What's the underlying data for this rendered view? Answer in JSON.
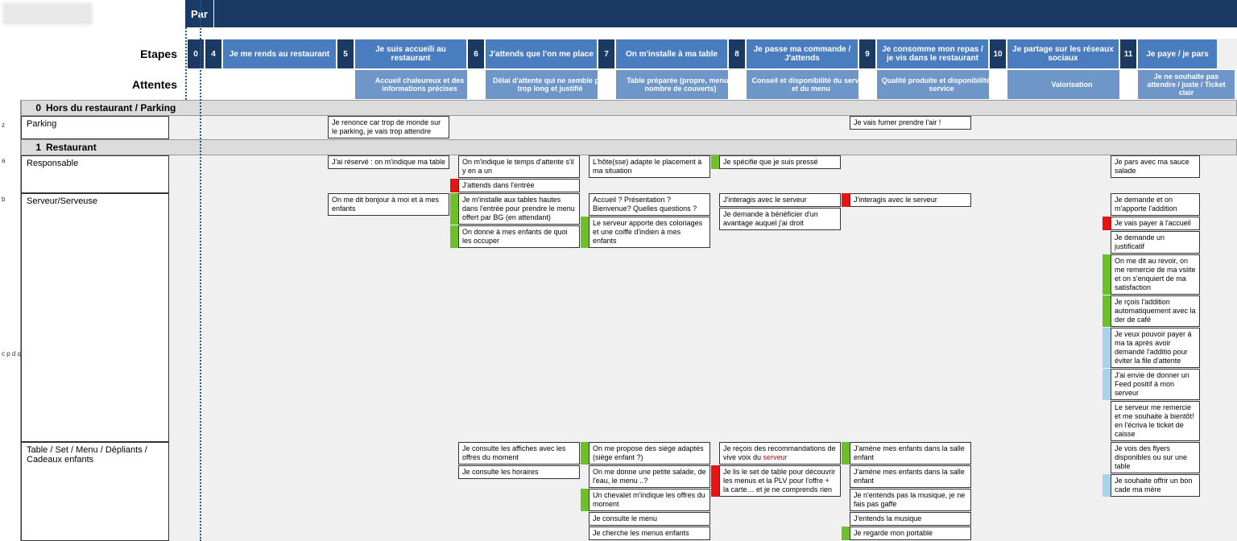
{
  "topbar": {
    "par_label": "Par"
  },
  "labels": {
    "etapes": "Etapes",
    "attentes": "Attentes"
  },
  "stages": [
    {
      "n": "0",
      "title": "",
      "attente": ""
    },
    {
      "n": "4",
      "title": "Je me rends au restaurant",
      "attente": ""
    },
    {
      "n": "5",
      "title": "Je suis accueili au restaurant",
      "attente": "Accueil chaleureux et des informations précises"
    },
    {
      "n": "6",
      "title": "J'attends que l'on me place",
      "attente": "Délai d'attente qui ne semble pas trop long et justifié"
    },
    {
      "n": "7",
      "title": "On m'installe à ma table",
      "attente": "Table préparée (propre, menus, nombre de couverts)"
    },
    {
      "n": "8",
      "title": "Je passe ma commande / J'attends",
      "attente": "Conseil et disponibilité du serveur et du menu"
    },
    {
      "n": "9",
      "title": "Je consomme mon repas / je vis dans le restaurant",
      "attente": "Qualité produite et disponibilité du service"
    },
    {
      "n": "10",
      "title": "Je partage sur les réseaux sociaux",
      "attente": "Valorisation"
    },
    {
      "n": "11",
      "title": "Je paye / je pars",
      "attente": "Je ne souhaite pas attendre / juste / Ticket clair"
    }
  ],
  "sections": [
    {
      "num": "0",
      "title": "Hors du restaurant / Parking"
    },
    {
      "num": "1",
      "title": "Restaurant"
    }
  ],
  "rows": {
    "parking": {
      "id": "z",
      "label": "Parking",
      "cols": {
        "c5": [
          {
            "tag": "none",
            "text": "Je renonce car trop de monde sur le parking, je vais trop attendre"
          }
        ],
        "c9": [
          {
            "tag": "none",
            "text": "Je vais fumer prendre l'air !"
          }
        ]
      }
    },
    "responsable": {
      "id": "a",
      "label": "Responsable",
      "cols": {
        "c5": [
          {
            "tag": "none",
            "text": "J'ai réservé : on m'indique ma table"
          }
        ],
        "c6": [
          {
            "tag": "none",
            "text": "On m'indique le temps d'attente s'il y en a un"
          },
          {
            "tag": "red",
            "text": "J'attends dans l'entrée"
          }
        ],
        "c7": [
          {
            "tag": "none",
            "text": "L'hôte(sse) adapte le placement à ma situation"
          }
        ],
        "c8": [
          {
            "tag": "green",
            "text": "Je spécifie que je suis pressé"
          }
        ],
        "c11": [
          {
            "tag": "none",
            "text": "Je pars avec ma sauce salade"
          }
        ]
      }
    },
    "serveur": {
      "id": "b",
      "label": "Serveur/Serveuse",
      "cols": {
        "c5": [
          {
            "tag": "none",
            "text": "On me dit bonjour à moi et à mes enfants"
          }
        ],
        "c6": [
          {
            "tag": "green",
            "text": "Je m'installe aux tables hautes dans l'entrée pour prendre le menu offert par BG (en attendant)"
          },
          {
            "tag": "green",
            "text": "On donne à mes enfants de quoi les occuper"
          }
        ],
        "c7": [
          {
            "tag": "none",
            "text": "Accueil ? Présentation ? Bienvenue? Quelles questions ?"
          },
          {
            "tag": "green",
            "text": "Le serveur apporte des coloriages et une coiffe d'indien à mes enfants"
          }
        ],
        "c8": [
          {
            "tag": "none",
            "text": "J'interagis avec le serveur"
          },
          {
            "tag": "none",
            "text": "Je demande à bénéficier d'un avantage auquel j'ai droit"
          }
        ],
        "c9": [
          {
            "tag": "red",
            "text": "J'interagis avec le serveur"
          }
        ],
        "c11": [
          {
            "tag": "none",
            "text": "Je demande et on m'apporte l'addition"
          },
          {
            "tag": "red",
            "text": "Je vais payer à l'accueil"
          },
          {
            "tag": "none",
            "text": "Je demande un justificatif"
          },
          {
            "tag": "green",
            "text": "On me dit au revoir, on me remercie de ma vsiite et on s'enquiert de ma satisfaction"
          },
          {
            "tag": "green",
            "text": "Je rçois l'addition automatiquement avec la der de café"
          },
          {
            "tag": "blue",
            "text": "Je veux pouvoir payer à ma ta après avoir demandé l'additio pour éviter la file d'attente"
          },
          {
            "tag": "blue",
            "text": "J'ai envie de donner un Feed positif à mon serveur"
          },
          {
            "tag": "none",
            "text": "Le serveur me remercie et me souhaite à bientôt! en l'écriva le ticket de caisse"
          }
        ]
      }
    },
    "table": {
      "id": "c p d q r",
      "label": "Table / Set / Menu / Dépliants / Cadeaux enfants",
      "cols": {
        "c6": [
          {
            "tag": "none",
            "text": "Je consulte les affiches avec les offres du moment"
          },
          {
            "tag": "none",
            "text": "Je consulte les horaires"
          }
        ],
        "c7": [
          {
            "tag": "green",
            "text": "On me propose des siège adaptés (siège enfant ?)"
          },
          {
            "tag": "none",
            "text": "On me donne une petite salade, de l'eau, le menu ..?"
          },
          {
            "tag": "green",
            "text": "Un chevalet m'indique les offres du moment"
          },
          {
            "tag": "none",
            "text": "Je consulte le menu"
          },
          {
            "tag": "none",
            "text": "Je cherche les menus enfants"
          }
        ],
        "c8": [
          {
            "tag": "none",
            "text": "Je reçois des recommandations de vive voix du ",
            "kw": "serveur"
          },
          {
            "tag": "red",
            "text": "Je lis le set de table pour découvrir les menus et la PLV pour l'offre + la carte… et je ne comprends rien"
          }
        ],
        "c9": [
          {
            "tag": "green",
            "text": "J'amène mes enfants dans la salle enfant"
          },
          {
            "tag": "none",
            "text": "J'amène mes enfants dans la salle enfant"
          },
          {
            "tag": "none",
            "text": "Je n'entends pas la musique, je ne fais pas gaffe"
          },
          {
            "tag": "none",
            "text": "J'entends la musique"
          },
          {
            "tag": "green",
            "text": "Je regarde mon portable"
          }
        ],
        "c11": [
          {
            "tag": "none",
            "text": "Je vois des flyers disponibles ou sur une table"
          },
          {
            "tag": "blue",
            "text": "Je souhaite offrir un bon cade ma mère"
          }
        ]
      }
    }
  }
}
